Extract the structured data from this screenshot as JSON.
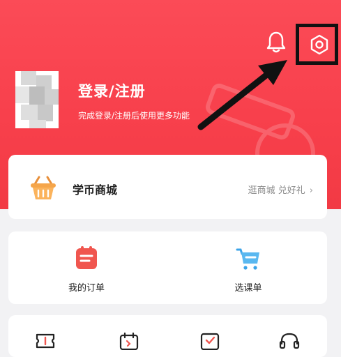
{
  "header": {
    "login_title": "登录/注册",
    "login_subtitle": "完成登录/注册后使用更多功能",
    "bell_icon": "bell-icon",
    "settings_icon": "settings-icon",
    "accent_color": "#f8404c"
  },
  "mall": {
    "title": "学币商城",
    "link": "逛商城 兑好礼",
    "chevron": "›"
  },
  "orders": {
    "items": [
      {
        "label": "我的订单",
        "icon": "order-list-icon"
      },
      {
        "label": "选课单",
        "icon": "shopping-cart-icon"
      }
    ]
  },
  "tools": {
    "icons": [
      "ticket-icon",
      "calendar-icon",
      "checklist-icon",
      "headset-icon"
    ]
  }
}
